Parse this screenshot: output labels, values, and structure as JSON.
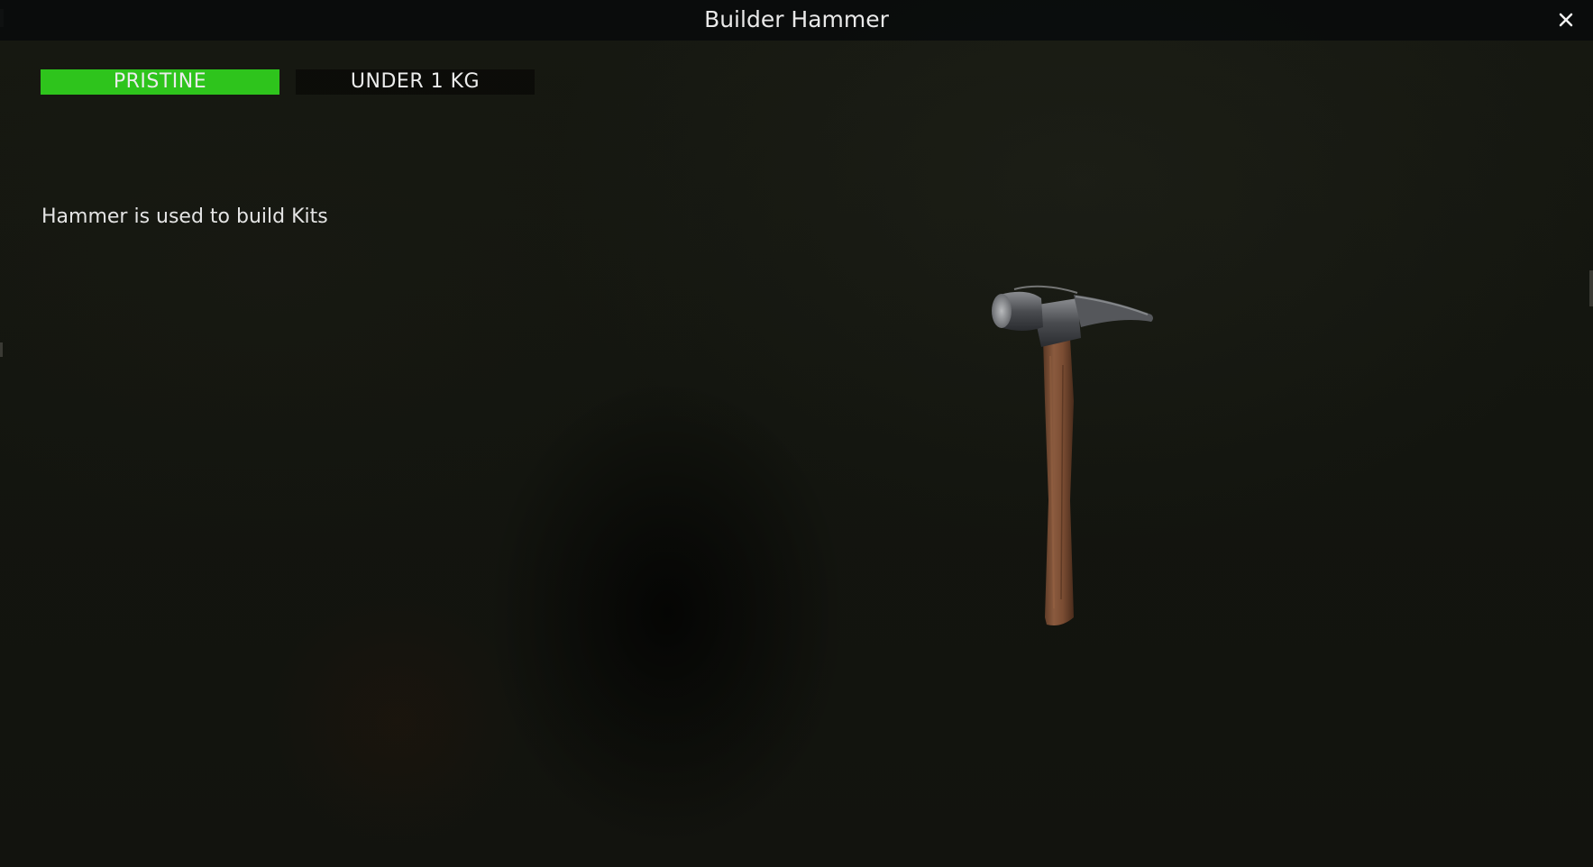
{
  "window": {
    "title": "Builder Hammer",
    "close_icon": "close-icon"
  },
  "item": {
    "condition": "PRISTINE",
    "condition_color": "#2ec41c",
    "weight": "UNDER 1 KG",
    "description": "Hammer is used to build Kits",
    "preview_icon": "hammer-icon"
  }
}
